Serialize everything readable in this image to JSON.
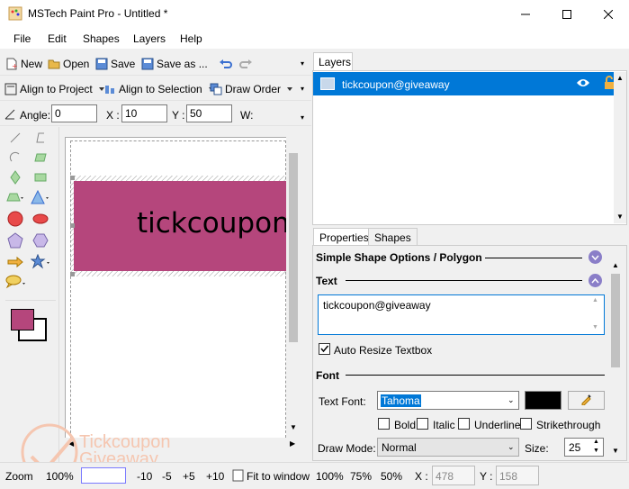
{
  "window": {
    "title": "MSTech Paint Pro - Untitled *"
  },
  "menu": [
    "File",
    "Edit",
    "Shapes",
    "Layers",
    "Help"
  ],
  "toolbar1": {
    "new": "New",
    "open": "Open",
    "save": "Save",
    "save_as": "Save as ..."
  },
  "toolbar2": {
    "align_project": "Align to Project",
    "align_selection": "Align to Selection",
    "draw_order": "Draw Order"
  },
  "toolbar3": {
    "angle_label": "Angle:",
    "angle": "0",
    "x_label": "X :",
    "x": "10",
    "y_label": "Y :",
    "y": "50",
    "w_label": "W:"
  },
  "canvas": {
    "shape_text": "tickcoupon",
    "shape_color": "#b5467c"
  },
  "colors": {
    "primary": "#b5467c",
    "secondary": "#ffffff"
  },
  "layers": {
    "tab": "Layers",
    "items": [
      {
        "name": "tickcoupon@giveaway"
      }
    ]
  },
  "props": {
    "tabs": [
      "Properties",
      "Shapes"
    ],
    "section_shape": "Simple Shape Options / Polygon",
    "section_text": "Text",
    "text_value": "tickcoupon@giveaway",
    "auto_resize": "Auto Resize Textbox",
    "section_font": "Font",
    "text_font_label": "Text Font:",
    "text_font": "Tahoma",
    "bold": "Bold",
    "italic": "Italic",
    "underline": "Underline",
    "strikethrough": "Strikethrough",
    "draw_mode_label": "Draw Mode:",
    "draw_mode": "Normal",
    "size_label": "Size:",
    "size": "25"
  },
  "status": {
    "zoom_label": "Zoom",
    "zoom": "100%",
    "m10": "-10",
    "m5": "-5",
    "p5": "+5",
    "p10": "+10",
    "fit": "Fit to window",
    "z100": "100%",
    "z75": "75%",
    "z50": "50%",
    "x_label": "X :",
    "x": "478",
    "y_label": "Y :",
    "y": "158"
  },
  "watermark": {
    "line1": "Tickcoupon",
    "line2": "Giveaway"
  }
}
